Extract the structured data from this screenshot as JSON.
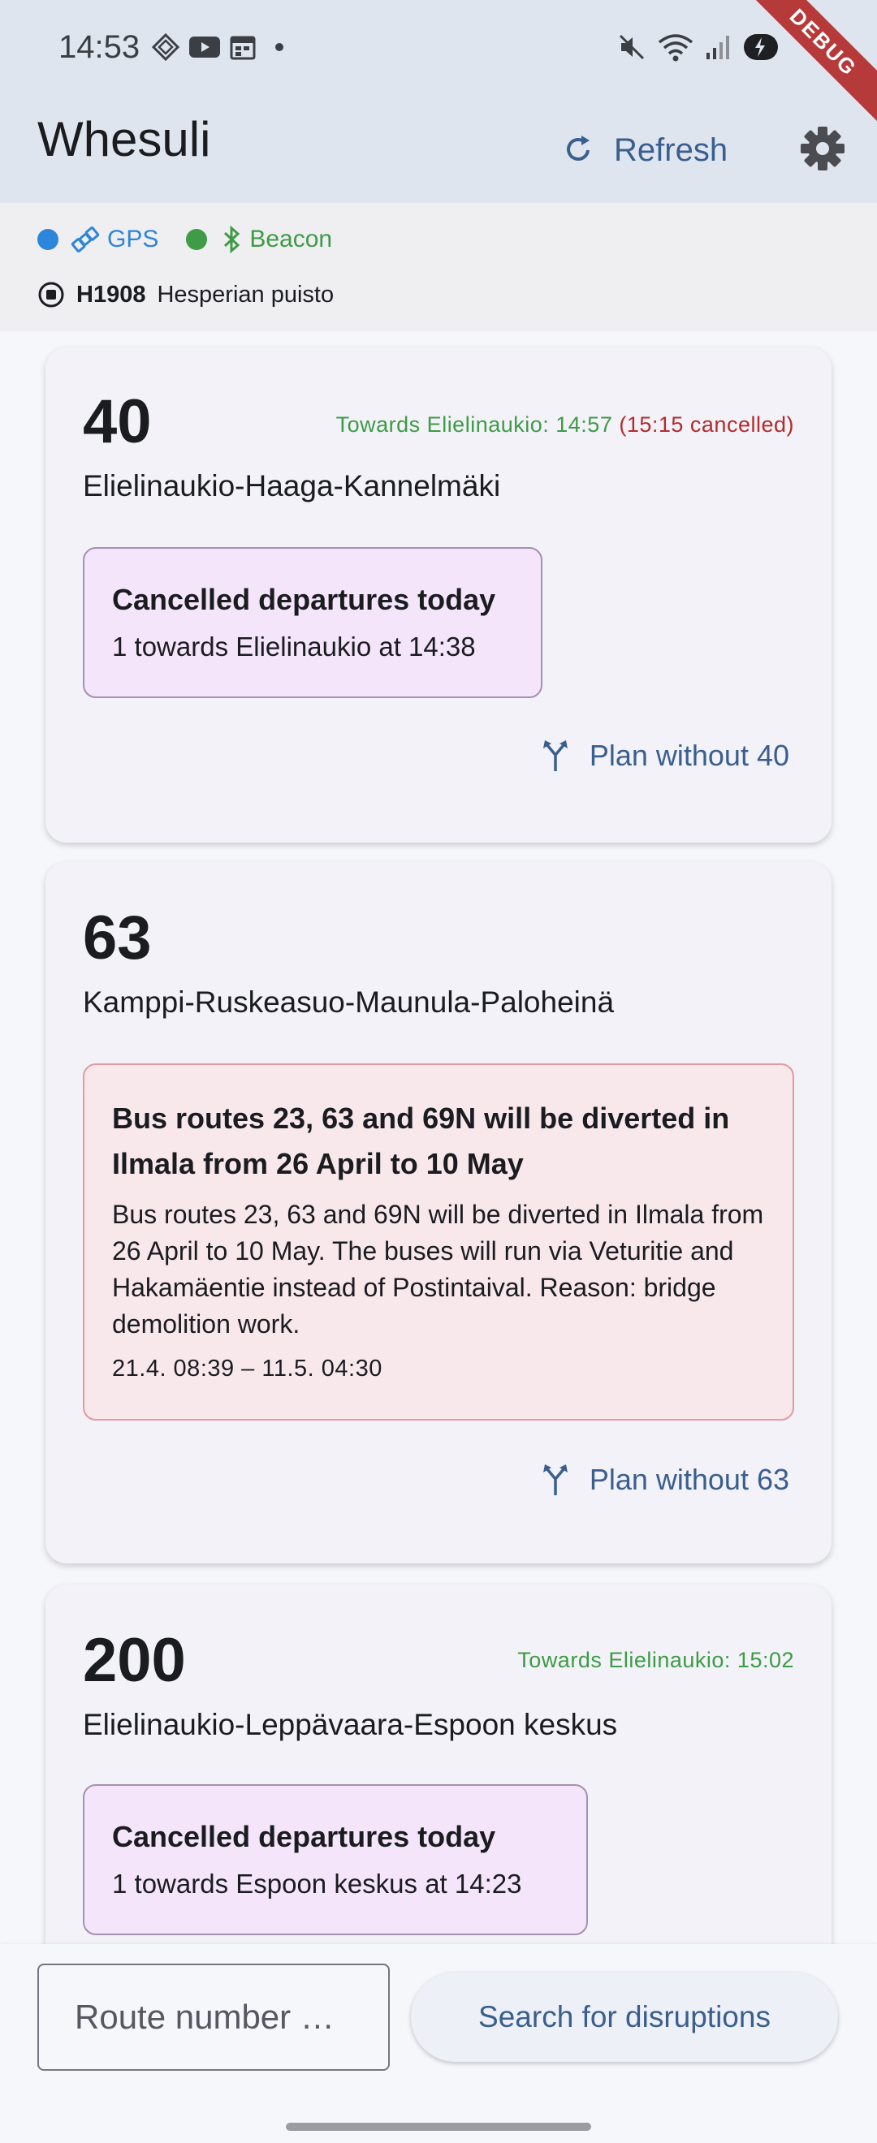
{
  "status_bar": {
    "time": "14:53",
    "debug_label": "DEBUG"
  },
  "app_bar": {
    "title": "Whesuli",
    "refresh_label": "Refresh"
  },
  "location": {
    "gps_label": "GPS",
    "beacon_label": "Beacon",
    "stop_code": "H1908",
    "stop_name": "Hesperian puisto",
    "colors": {
      "gps": "#2d86d9",
      "beacon": "#3e9b46"
    }
  },
  "routes": [
    {
      "number": "40",
      "name": "Elielinaukio-Haaga-Kannelmäki",
      "departures_ok": "Towards Elielinaukio: 14:57",
      "departures_cancelled": "(15:15 cancelled)",
      "cancelled_title": "Cancelled departures today",
      "cancelled_line": "1 towards Elielinaukio at 14:38",
      "plan_label": "Plan without 40"
    },
    {
      "number": "63",
      "name": "Kamppi-Ruskeasuo-Maunula-Paloheinä",
      "alert_title": "Bus routes 23, 63 and 69N will be diverted in Ilmala from 26 April to 10 May",
      "alert_body": "Bus routes 23, 63 and 69N will be diverted in Ilmala from 26 April to 10 May. The buses will run via Veturitie and Hakamäentie instead of Postintaival. Reason: bridge demolition work.",
      "alert_range": "21.4. 08:39 – 11.5. 04:30",
      "plan_label": "Plan without 63"
    },
    {
      "number": "200",
      "name": "Elielinaukio-Leppävaara-Espoon keskus",
      "departures_ok": "Towards Elielinaukio: 15:02",
      "cancelled_title": "Cancelled departures today",
      "cancelled_line": "1 towards Espoon keskus at 14:23"
    }
  ],
  "search": {
    "placeholder": "Route number …",
    "button_label": "Search for disruptions"
  },
  "theme": {
    "accent": "#3a5f8f",
    "ok": "#3e9b46",
    "cancel": "#b52b2b"
  }
}
